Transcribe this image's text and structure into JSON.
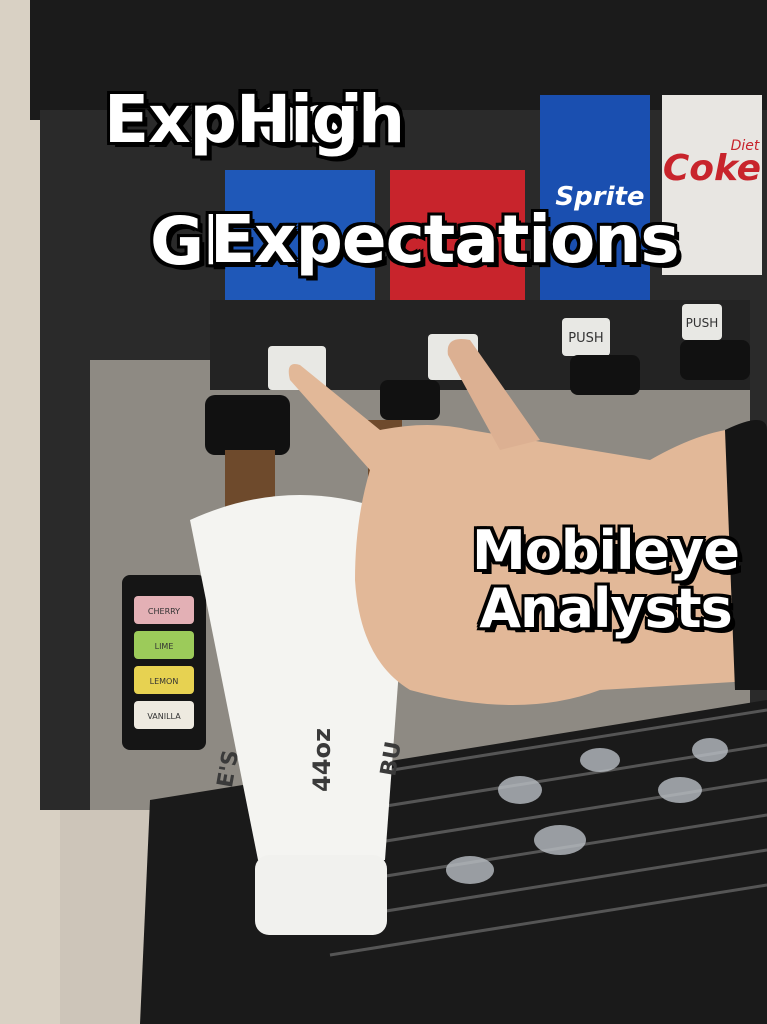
{
  "captions": {
    "overlay_a": "Explosi",
    "overlay_b": "Gl",
    "overlay_c": "Expectations",
    "overlay_d": "High",
    "right_label": "Mobileye\nAnalysts"
  },
  "machine": {
    "button_label": "PUSH",
    "brand_sprite": "Sprite",
    "brand_coke": "Coke",
    "brand_diet": "Diet",
    "flavors": [
      "CHERRY",
      "LIME",
      "LEMON",
      "VANILLA"
    ]
  },
  "cup": {
    "size_label": "44oz",
    "print_a": "E'S",
    "print_b": "BU"
  },
  "colors": {
    "blue_panel": "#1f58b8",
    "red_panel": "#c8242c",
    "sprite_panel": "#1a4fb0",
    "coke_panel": "#e8e6e2",
    "soda": "#6e4a2c"
  }
}
